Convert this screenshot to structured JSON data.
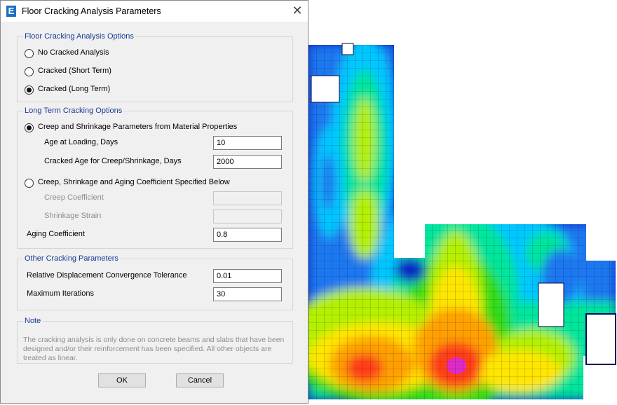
{
  "dialog": {
    "title": "Floor Cracking Analysis Parameters",
    "app_icon": "E",
    "close_glyph": "✕"
  },
  "options_group": {
    "legend": "Floor Cracking Analysis Options",
    "options": [
      {
        "label": "No Cracked Analysis",
        "selected": false
      },
      {
        "label": "Cracked  (Short Term)",
        "selected": false
      },
      {
        "label": "Cracked  (Long Term)",
        "selected": true
      }
    ]
  },
  "long_term_group": {
    "legend": "Long Term Cracking Options",
    "material_option": {
      "label": "Creep and Shrinkage Parameters from Material Properties",
      "selected": true
    },
    "age_at_loading": {
      "label": "Age at Loading,  Days",
      "value": "10"
    },
    "cracked_age": {
      "label": "Cracked Age for Creep/Shrinkage,  Days",
      "value": "2000"
    },
    "specified_option": {
      "label": "Creep, Shrinkage and Aging Coefficient Specified Below",
      "selected": false
    },
    "creep_coefficient": {
      "label": "Creep Coefficient",
      "value": "",
      "enabled": false
    },
    "shrinkage_strain": {
      "label": "Shrinkage Strain",
      "value": "",
      "enabled": false
    },
    "aging_coefficient": {
      "label": "Aging Coefficient",
      "value": "0.8"
    }
  },
  "other_group": {
    "legend": "Other Cracking Parameters",
    "tolerance": {
      "label": "Relative Displacement Convergence Tolerance",
      "value": "0.01"
    },
    "max_iterations": {
      "label": "Maximum Iterations",
      "value": "30"
    }
  },
  "note_group": {
    "legend": "Note",
    "text": "The cracking analysis is only done on concrete beams and slabs that have been designed and/or their reinforcement has been specified. All other objects are treated as linear."
  },
  "buttons": {
    "ok": "OK",
    "cancel": "Cancel"
  },
  "colors": {
    "legend_text": "#1a3896",
    "contour_scale": [
      "#0a28c8",
      "#1e78f0",
      "#00c8ff",
      "#00e69b",
      "#32dc14",
      "#b4f000",
      "#ffe600",
      "#ffa000",
      "#ff3c14",
      "#ff00ff"
    ]
  }
}
